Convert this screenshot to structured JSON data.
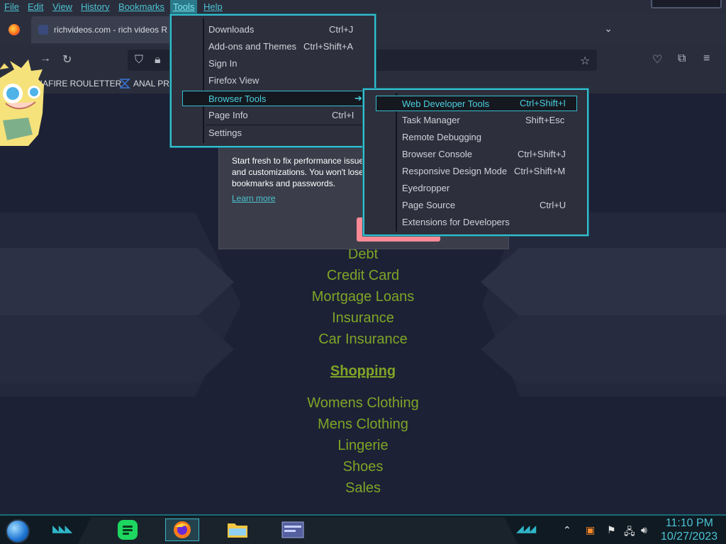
{
  "menubar": {
    "items": [
      "File",
      "Edit",
      "View",
      "History",
      "Bookmarks",
      "Tools",
      "Help"
    ]
  },
  "tab": {
    "title": "richvideos.com - rich videos R"
  },
  "bookmarks": {
    "items": [
      "DIAFIRE ROULETTER",
      "ANAL PRO"
    ]
  },
  "popup": {
    "text": "Start fresh to fix performance issues and customizations. You won't lose bookmarks and passwords.",
    "link": "Learn more"
  },
  "tools_menu": {
    "items": [
      {
        "label": "Downloads",
        "shortcut": "Ctrl+J"
      },
      {
        "label": "Add-ons and Themes",
        "shortcut": "Ctrl+Shift+A"
      },
      {
        "label": "Sign In",
        "shortcut": ""
      },
      {
        "label": "Firefox View",
        "shortcut": ""
      },
      {
        "label": "Browser Tools",
        "shortcut": ""
      },
      {
        "label": "Page Info",
        "shortcut": "Ctrl+I"
      },
      {
        "label": "Settings",
        "shortcut": ""
      }
    ]
  },
  "dev_menu": {
    "items": [
      {
        "label": "Web Developer Tools",
        "shortcut": "Ctrl+Shift+I"
      },
      {
        "label": "Task Manager",
        "shortcut": "Shift+Esc"
      },
      {
        "label": "Remote Debugging",
        "shortcut": ""
      },
      {
        "label": "Browser Console",
        "shortcut": "Ctrl+Shift+J"
      },
      {
        "label": "Responsive Design Mode",
        "shortcut": "Ctrl+Shift+M"
      },
      {
        "label": "Eyedropper",
        "shortcut": ""
      },
      {
        "label": "Page Source",
        "shortcut": "Ctrl+U"
      },
      {
        "label": "Extensions for Developers",
        "shortcut": ""
      }
    ]
  },
  "page": {
    "links_top": [
      "Debt",
      "Credit Card",
      "Mortgage Loans",
      "Insurance",
      "Car Insurance"
    ],
    "heading": "Shopping",
    "links_bottom": [
      "Womens Clothing",
      "Mens Clothing",
      "Lingerie",
      "Shoes",
      "Sales"
    ]
  },
  "taskbar": {
    "time": "11:10 PM",
    "date": "10/27/2023"
  },
  "colors": {
    "accent": "#33c0d0",
    "link_green": "#7fa526",
    "menu_bg": "#2e2f3c"
  }
}
